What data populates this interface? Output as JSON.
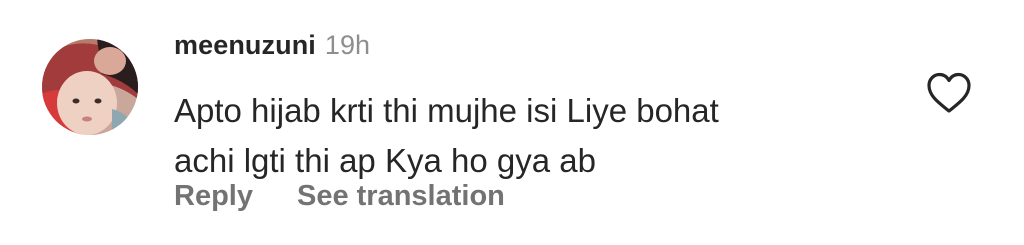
{
  "comment": {
    "username": "meenuzuni",
    "timestamp": "19h",
    "text_line1": "Apto hijab krti thi mujhe isi Liye bohat",
    "text_line2": "achi lgti thi ap Kya ho gya ab",
    "actions": {
      "reply_label": "Reply",
      "translate_label": "See translation"
    },
    "like_icon": "heart-outline-icon",
    "avatar": "profile-photo-avatar"
  },
  "colors": {
    "username": "#262626",
    "timestamp": "#8e8e8e",
    "body": "#262626",
    "actions": "#737373",
    "icon": "#262626"
  }
}
